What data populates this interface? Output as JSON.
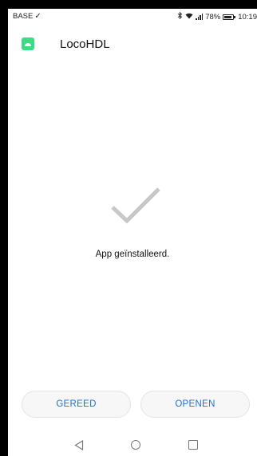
{
  "status_bar": {
    "carrier": "BASE",
    "battery_percent": "78%",
    "time": "10:19",
    "icons": [
      "download-done-icon",
      "bluetooth-icon",
      "wifi-icon",
      "signal-icon",
      "battery-icon"
    ]
  },
  "app": {
    "name": "LocoHDL",
    "icon": "android-icon",
    "icon_color": "#3ddc84"
  },
  "main": {
    "status_icon": "checkmark-icon",
    "message": "App geïnstalleerd."
  },
  "buttons": {
    "done_label": "GEREED",
    "open_label": "OPENEN",
    "accent_color": "#1a73d0"
  },
  "nav": {
    "icons": [
      "back-icon",
      "home-icon",
      "recents-icon"
    ]
  }
}
